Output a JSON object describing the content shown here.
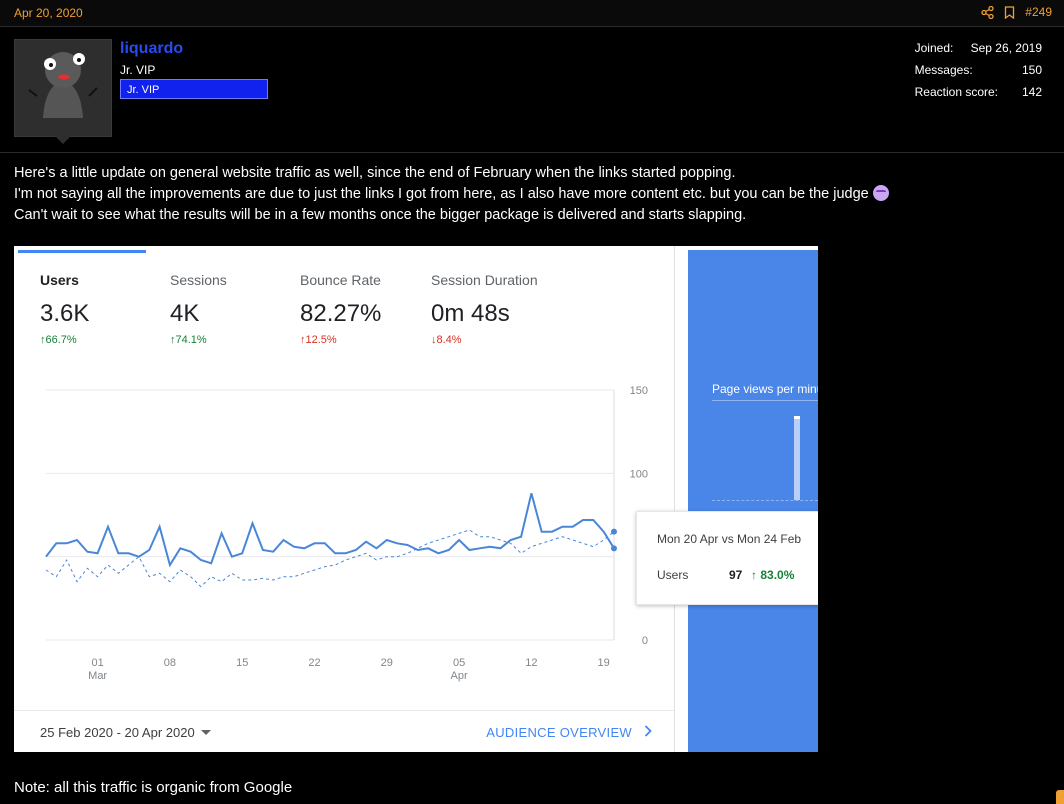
{
  "post": {
    "date": "Apr 20, 2020",
    "number": "#249",
    "share_icon": "share-icon",
    "bookmark_icon": "bookmark-icon"
  },
  "user": {
    "name": "liquardo",
    "title": "Jr. VIP",
    "banner": "Jr. VIP",
    "avatar": "avatar",
    "stats": [
      {
        "label": "Joined:",
        "value": "Sep 26, 2019"
      },
      {
        "label": "Messages:",
        "value": "150"
      },
      {
        "label": "Reaction score:",
        "value": "142"
      }
    ]
  },
  "body": {
    "line1": "Here's a little update on general website traffic as well, since the end of February when the links started popping.",
    "line2": "I'm not saying all the improvements are due to just the links I got from here, as I also have more content etc. but you can be the judge",
    "line3": "Can't wait to see what the results will be in a few months once the bigger package is delivered and starts slapping.",
    "emoji": "relieved-face-emoji",
    "note": "Note: all this traffic is organic from Google"
  },
  "analytics": {
    "metrics": [
      {
        "label": "Users",
        "value": "3.6K",
        "change": "66.7%",
        "direction": "up"
      },
      {
        "label": "Sessions",
        "value": "4K",
        "change": "74.1%",
        "direction": "up"
      },
      {
        "label": "Bounce Rate",
        "value": "82.27%",
        "change": "12.5%",
        "direction": "up-bad"
      },
      {
        "label": "Session Duration",
        "value": "0m 48s",
        "change": "8.4%",
        "direction": "down"
      }
    ],
    "tooltip": {
      "title": "Mon 20 Apr vs Mon 24 Feb",
      "label": "Users",
      "value": "97",
      "change": "83.0%"
    },
    "date_range": "25 Feb 2020 - 20 Apr 2020",
    "audience_link": "AUDIENCE OVERVIEW",
    "side_panel": {
      "label": "Page views per minute"
    },
    "colors": {
      "primary": "#4285f4",
      "up": "#188038",
      "down": "#d93025",
      "panel": "#4a86e8",
      "accent": "#f0a030"
    }
  },
  "chart_data": {
    "type": "line",
    "x": [
      "2020-02-25",
      "2020-02-26",
      "2020-02-27",
      "2020-02-28",
      "2020-02-29",
      "2020-03-01",
      "2020-03-02",
      "2020-03-03",
      "2020-03-04",
      "2020-03-05",
      "2020-03-06",
      "2020-03-07",
      "2020-03-08",
      "2020-03-09",
      "2020-03-10",
      "2020-03-11",
      "2020-03-12",
      "2020-03-13",
      "2020-03-14",
      "2020-03-15",
      "2020-03-16",
      "2020-03-17",
      "2020-03-18",
      "2020-03-19",
      "2020-03-20",
      "2020-03-21",
      "2020-03-22",
      "2020-03-23",
      "2020-03-24",
      "2020-03-25",
      "2020-03-26",
      "2020-03-27",
      "2020-03-28",
      "2020-03-29",
      "2020-03-30",
      "2020-03-31",
      "2020-04-01",
      "2020-04-02",
      "2020-04-03",
      "2020-04-04",
      "2020-04-05",
      "2020-04-06",
      "2020-04-07",
      "2020-04-08",
      "2020-04-09",
      "2020-04-10",
      "2020-04-11",
      "2020-04-12",
      "2020-04-13",
      "2020-04-14",
      "2020-04-15",
      "2020-04-16",
      "2020-04-17",
      "2020-04-18",
      "2020-04-19",
      "2020-04-20"
    ],
    "x_ticks": [
      {
        "date": "2020-03-01",
        "label": "01",
        "sublabel": "Mar"
      },
      {
        "date": "2020-03-08",
        "label": "08",
        "sublabel": ""
      },
      {
        "date": "2020-03-15",
        "label": "15",
        "sublabel": ""
      },
      {
        "date": "2020-03-22",
        "label": "22",
        "sublabel": ""
      },
      {
        "date": "2020-03-29",
        "label": "29",
        "sublabel": ""
      },
      {
        "date": "2020-04-05",
        "label": "05",
        "sublabel": "Apr"
      },
      {
        "date": "2020-04-12",
        "label": "12",
        "sublabel": ""
      },
      {
        "date": "2020-04-19",
        "label": "19",
        "sublabel": ""
      }
    ],
    "y_ticks": [
      0,
      50,
      100,
      150
    ],
    "y_tick_labels": [
      "0",
      "",
      "100",
      "150"
    ],
    "ylim": [
      0,
      150
    ],
    "grid": true,
    "series": [
      {
        "style": "solid",
        "color": "#4a86d8",
        "values": [
          50,
          58,
          58,
          60,
          53,
          52,
          68,
          52,
          52,
          50,
          54,
          68,
          45,
          55,
          53,
          48,
          46,
          64,
          50,
          52,
          70,
          54,
          53,
          60,
          56,
          55,
          58,
          58,
          52,
          52,
          54,
          59,
          55,
          60,
          58,
          57,
          54,
          55,
          52,
          54,
          60,
          54,
          55,
          56,
          55,
          60,
          62,
          88,
          65,
          65,
          68,
          68,
          72,
          72,
          65,
          55
        ]
      },
      {
        "style": "dashed",
        "color": "#4a86d8",
        "values": [
          42,
          38,
          48,
          35,
          43,
          38,
          45,
          40,
          45,
          50,
          38,
          40,
          35,
          42,
          38,
          32,
          38,
          35,
          40,
          36,
          36,
          37,
          36,
          38,
          38,
          40,
          42,
          44,
          45,
          48,
          50,
          52,
          48,
          50,
          50,
          52,
          55,
          58,
          60,
          62,
          64,
          66,
          62,
          62,
          60,
          58,
          52,
          56,
          58,
          60,
          62,
          60,
          58,
          56,
          60,
          65
        ]
      }
    ]
  }
}
